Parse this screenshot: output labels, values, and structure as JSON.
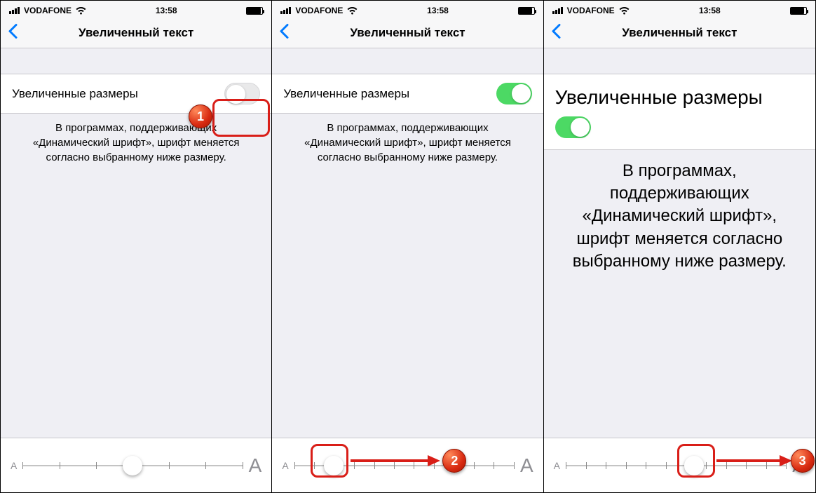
{
  "status": {
    "carrier": "VODAFONE",
    "time": "13:58"
  },
  "nav": {
    "title": "Увеличенный текст"
  },
  "setting": {
    "label": "Увеличенные размеры",
    "description": "В программах, поддерживающих «Динамический шрифт», шрифт меняется согласно выбранному ниже размеру."
  },
  "slider": {
    "small_letter": "A",
    "large_letter": "A"
  },
  "callouts": {
    "one": "1",
    "two": "2",
    "three": "3"
  },
  "screens": [
    {
      "toggle_on": false,
      "slider_percent": 50,
      "ticks": 7
    },
    {
      "toggle_on": true,
      "slider_percent": 18,
      "ticks": 12
    },
    {
      "toggle_on": true,
      "slider_percent": 58,
      "ticks": 12
    }
  ]
}
